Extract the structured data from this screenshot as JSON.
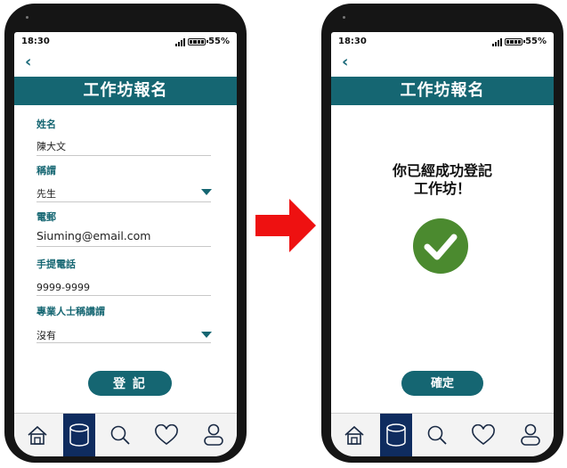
{
  "status_bar": {
    "time": "18:30",
    "battery": "55%"
  },
  "registration_form": {
    "header_title": "工作坊報名",
    "fields": [
      {
        "label": "姓名",
        "value": "陳大文"
      },
      {
        "label": "稱謂",
        "value": "先生"
      },
      {
        "label": "電郵",
        "value": "Siuming@email.com"
      },
      {
        "label": "手提電話",
        "value": "9999-9999"
      },
      {
        "label": "專業人士稱講謂",
        "value": "沒有"
      }
    ],
    "submit_label": "登 記"
  },
  "confirmation": {
    "header_title": "工作坊報名",
    "message_line1": "你已經成功登記",
    "message_line2": "工作坊！",
    "confirm_label": "確定"
  },
  "icons": [
    "home-icon",
    "database-icon",
    "search-icon",
    "heart-icon",
    "user-icon"
  ],
  "colors": {
    "brand": "#156672",
    "nav_active": "#0f2c5f",
    "arrow": "#ee1111",
    "check": "#4b8a2f"
  }
}
